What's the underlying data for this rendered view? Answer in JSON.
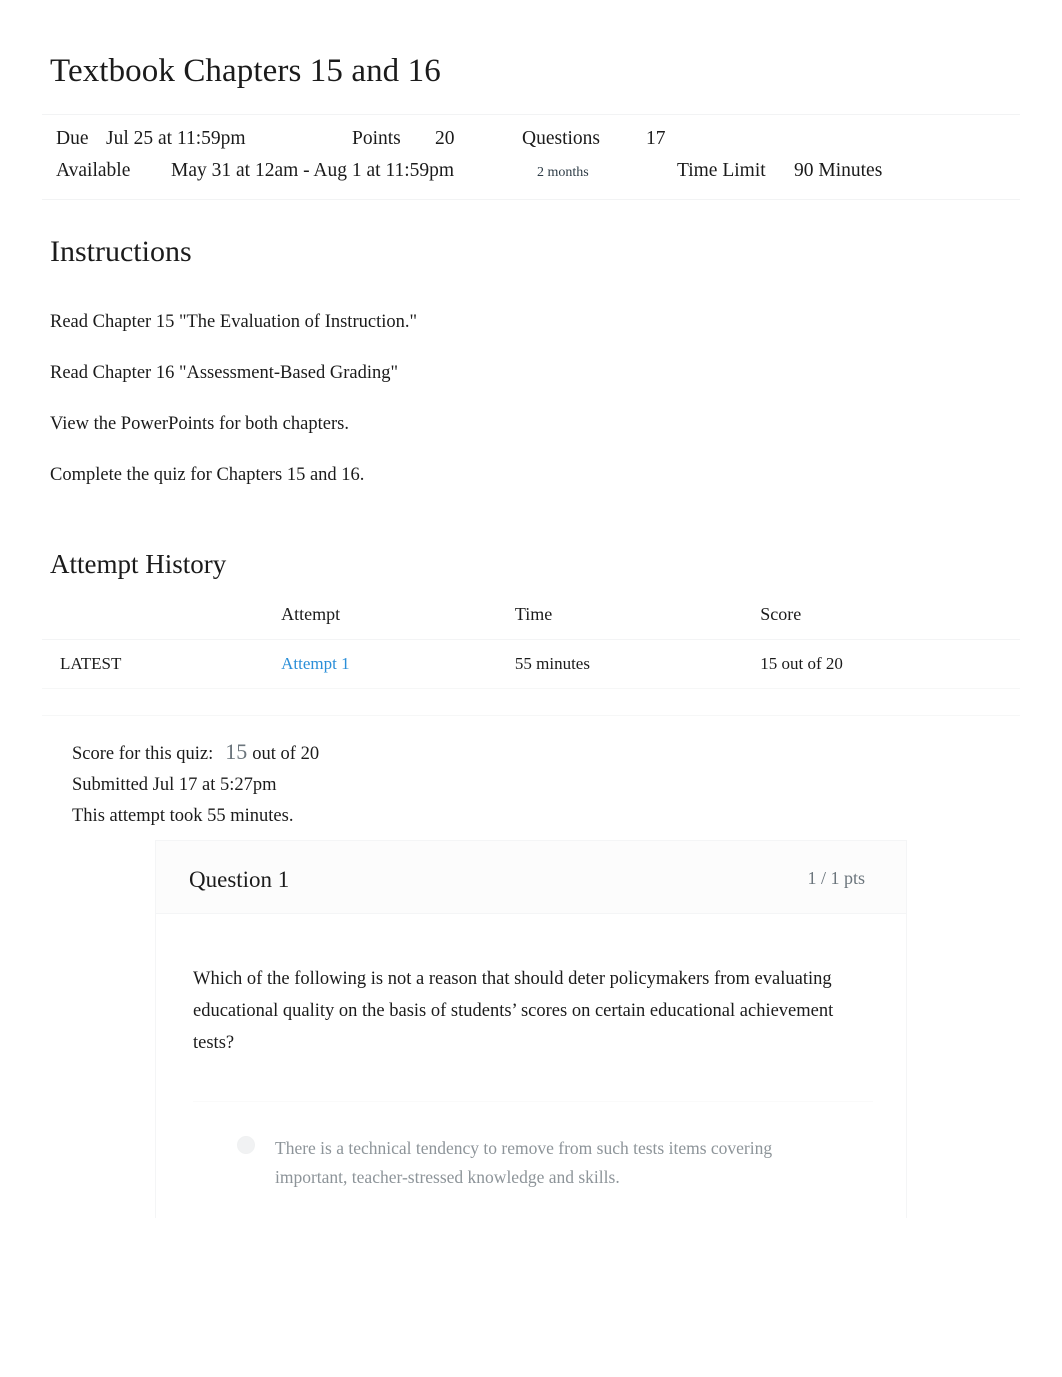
{
  "page": {
    "title": "Textbook Chapters 15 and 16"
  },
  "quiz_header": {
    "due_label": "Due",
    "due_value": "Jul 25 at 11:59pm",
    "points_label": "Points",
    "points_value": "20",
    "questions_label": "Questions",
    "questions_value": "17",
    "available_label": "Available",
    "available_value": "May 31 at 12am - Aug 1 at 11:59pm",
    "duration_value": "2 months",
    "time_limit_label": "Time Limit",
    "time_limit_value": "90 Minutes"
  },
  "instructions": {
    "heading": "Instructions",
    "paragraphs": [
      "Read Chapter 15 \"The Evaluation of Instruction.\"",
      "Read Chapter 16 \"Assessment-Based Grading\"",
      "View the PowerPoints for both chapters.",
      "Complete the quiz for Chapters 15 and 16."
    ]
  },
  "attempt_history": {
    "heading": "Attempt History",
    "columns": [
      "",
      "Attempt",
      "Time",
      "Score"
    ],
    "rows": [
      {
        "latest": "LATEST",
        "attempt": "Attempt 1",
        "time": "55 minutes",
        "score": "15 out of 20"
      }
    ]
  },
  "score_summary": {
    "score_label": "Score for this quiz:",
    "score_value": "15",
    "score_suffix": "out of 20",
    "submitted": "Submitted Jul 17 at 5:27pm",
    "duration": "This attempt took 55 minutes."
  },
  "question": {
    "name": "Question 1",
    "points": "1 / 1 pts",
    "text": "Which of the following is not a reason that should deter policymakers from evaluating educational quality on the basis of students’ scores on certain educational achievement tests?",
    "answers": [
      {
        "text": "There is a technical tendency to remove from such tests items covering important, teacher-stressed knowledge and skills."
      }
    ]
  },
  "colors": {
    "link": "#2b8fd8",
    "text": "#1b1b1b",
    "muted": "#6b757c",
    "answer_text": "#8d9499",
    "rule": "#f2f3f4"
  }
}
